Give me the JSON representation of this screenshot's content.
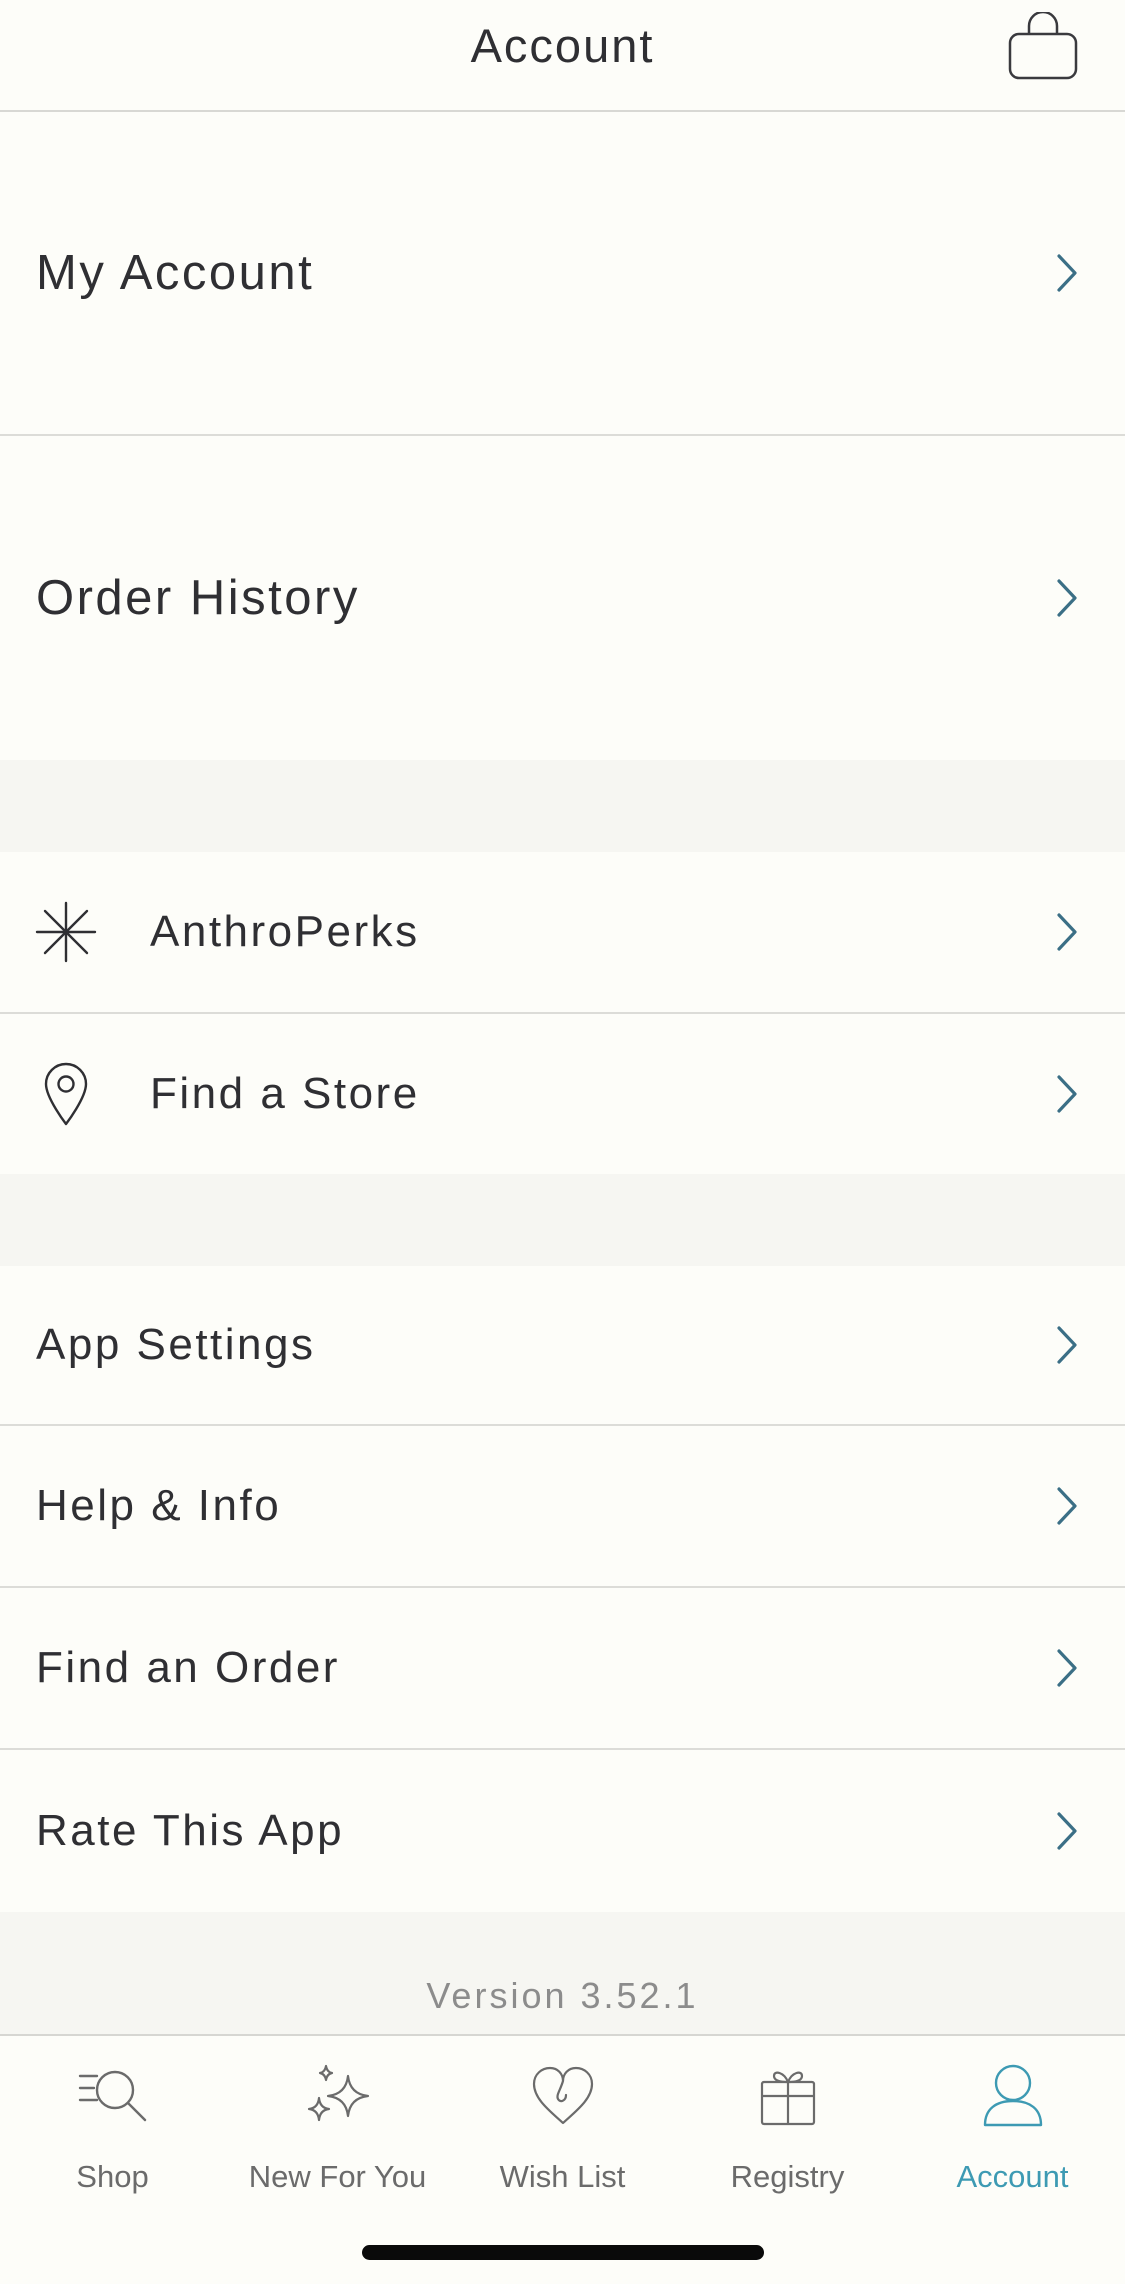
{
  "header": {
    "title": "Account",
    "cart_icon": "shopping-bag-icon"
  },
  "menu": {
    "my_account": "My Account",
    "order_history": "Order History",
    "anthroperks": "AnthroPerks",
    "find_store": "Find a Store",
    "app_settings": "App Settings",
    "help_info": "Help & Info",
    "find_order": "Find an Order",
    "rate_app": "Rate This App"
  },
  "icons": {
    "anthroperks": "asterisk-icon",
    "find_store": "map-pin-icon",
    "row_chevron": "chevron-right-icon"
  },
  "version": "Version 3.52.1",
  "tabs": [
    {
      "label": "Shop",
      "icon": "search-icon",
      "active": false
    },
    {
      "label": "New For You",
      "icon": "sparkle-icon",
      "active": false
    },
    {
      "label": "Wish List",
      "icon": "heart-icon",
      "active": false
    },
    {
      "label": "Registry",
      "icon": "gift-icon",
      "active": false
    },
    {
      "label": "Account",
      "icon": "user-icon",
      "active": true
    }
  ],
  "colors": {
    "background": "#fdfdf9",
    "section_gap": "#f6f6f2",
    "chevron": "#3b6f86",
    "active_tab": "#3d9ab3",
    "text": "#2f2f33"
  }
}
